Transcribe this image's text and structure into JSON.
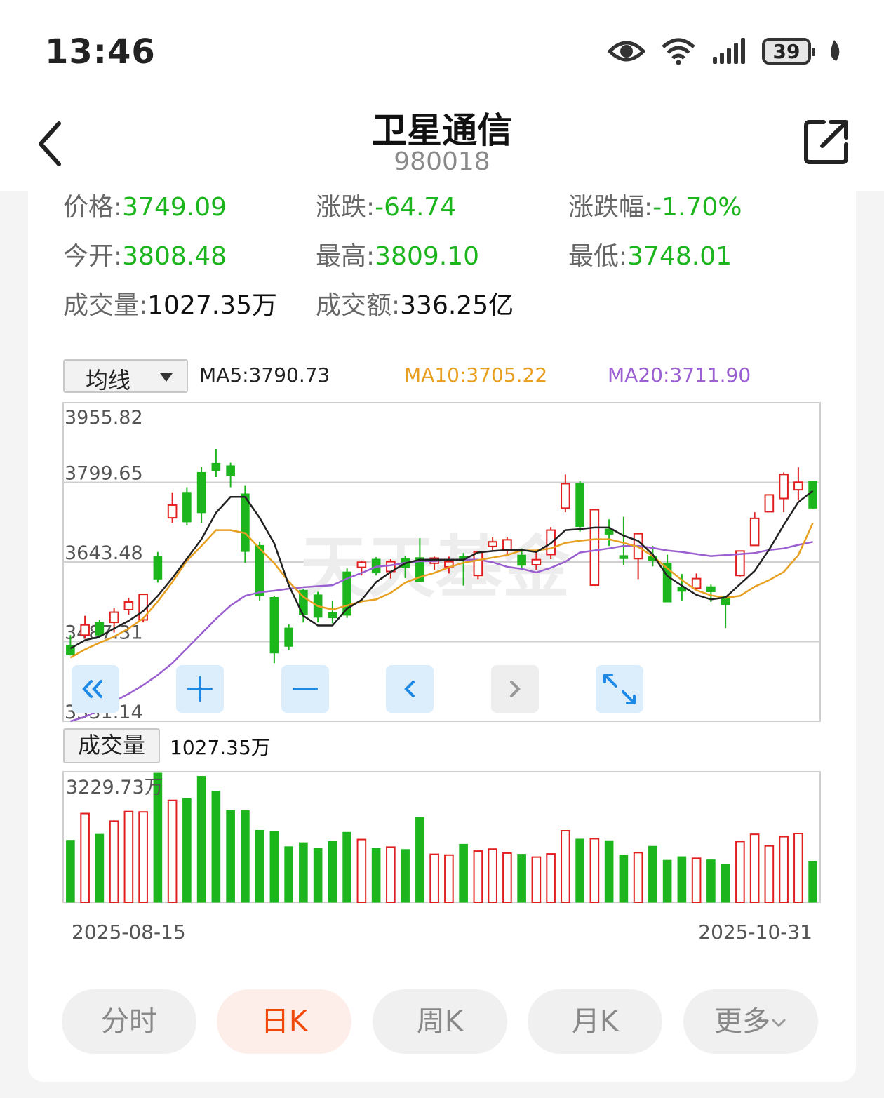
{
  "status_bar": {
    "time": "13:46",
    "battery": "39"
  },
  "header": {
    "title": "卫星通信",
    "code": "980018"
  },
  "quote": {
    "price_label": "价格:",
    "price": "3749.09",
    "change_label": "涨跌:",
    "change": "-64.74",
    "pct_label": "涨跌幅:",
    "pct": "-1.70%",
    "open_label": "今开:",
    "open": "3808.48",
    "high_label": "最高:",
    "high": "3809.10",
    "low_label": "最低:",
    "low": "3748.01",
    "volume_label": "成交量:",
    "volume": "1027.35万",
    "amount_label": "成交额:",
    "amount": "336.25亿"
  },
  "indicator": {
    "select_label": "均线",
    "ma5": "MA5:3790.73",
    "ma10": "MA10:3705.22",
    "ma20": "MA20:3711.90"
  },
  "volume_panel": {
    "label": "成交量",
    "value": "1027.35万"
  },
  "dates": {
    "start": "2025-08-15",
    "end": "2025-10-31"
  },
  "tabs": [
    {
      "label": "分时",
      "active": false
    },
    {
      "label": "日K",
      "active": true
    },
    {
      "label": "周K",
      "active": false
    },
    {
      "label": "月K",
      "active": false
    },
    {
      "label": "更多",
      "active": false
    }
  ],
  "colors": {
    "up": "#e02020",
    "down": "#1db51d",
    "ma5": "#222222",
    "ma10": "#e8a020",
    "ma20": "#9a5fd0",
    "accent": "#f04a0a"
  },
  "chart_data": {
    "type": "candlestick",
    "price_ticks": [
      "3955.82",
      "3799.65",
      "3643.48",
      "3487.31",
      "3331.14"
    ],
    "ylim": [
      3331.14,
      3955.82
    ],
    "volume_max_label": "3229.73万",
    "volume_max": 3229.73,
    "watermark": "天天基金",
    "candles": [
      [
        3480,
        3462,
        3500,
        3460,
        1550
      ],
      [
        3500,
        3520,
        3538,
        3493,
        2220
      ],
      [
        3525,
        3500,
        3530,
        3495,
        1700
      ],
      [
        3525,
        3545,
        3553,
        3505,
        2030
      ],
      [
        3550,
        3565,
        3573,
        3540,
        2270
      ],
      [
        3530,
        3580,
        3580,
        3525,
        2260
      ],
      [
        3655,
        3610,
        3663,
        3603,
        3229
      ],
      [
        3730,
        3755,
        3780,
        3720,
        2550
      ],
      [
        3780,
        3722,
        3790,
        3715,
        2590
      ],
      [
        3819,
        3740,
        3830,
        3720,
        3150
      ],
      [
        3837,
        3822,
        3865,
        3810,
        2780
      ],
      [
        3832,
        3812,
        3838,
        3790,
        2300
      ],
      [
        3777,
        3664,
        3794,
        3642,
        2290
      ],
      [
        3676,
        3577,
        3683,
        3568,
        1800
      ],
      [
        3574,
        3465,
        3577,
        3445,
        1780
      ],
      [
        3514,
        3478,
        3521,
        3470,
        1390
      ],
      [
        3588,
        3540,
        3591,
        3525,
        1490
      ],
      [
        3579,
        3535,
        3585,
        3525,
        1350
      ],
      [
        3544,
        3534,
        3568,
        3523,
        1520
      ],
      [
        3624,
        3539,
        3631,
        3534,
        1750
      ],
      [
        3633,
        3643,
        3646,
        3617,
        1570
      ],
      [
        3649,
        3622,
        3653,
        3617,
        1350
      ],
      [
        3625,
        3644,
        3649,
        3611,
        1380
      ],
      [
        3650,
        3633,
        3656,
        3612,
        1320
      ],
      [
        3652,
        3605,
        3690,
        3605,
        2120
      ],
      [
        3641,
        3651,
        3654,
        3628,
        1200
      ],
      [
        3634,
        3644,
        3654,
        3621,
        1180
      ],
      [
        3655,
        3646,
        3661,
        3597,
        1450
      ],
      [
        3617,
        3663,
        3663,
        3610,
        1280
      ],
      [
        3674,
        3683,
        3692,
        3665,
        1330
      ],
      [
        3666,
        3687,
        3693,
        3660,
        1230
      ],
      [
        3657,
        3637,
        3670,
        3630,
        1200
      ],
      [
        3638,
        3648,
        3664,
        3628,
        1130
      ],
      [
        3658,
        3706,
        3712,
        3649,
        1210
      ],
      [
        3749,
        3797,
        3815,
        3741,
        1790
      ],
      [
        3798,
        3713,
        3802,
        3703,
        1580
      ],
      [
        3598,
        3746,
        3746,
        3598,
        1590
      ],
      [
        3708,
        3698,
        3727,
        3675,
        1540
      ],
      [
        3656,
        3650,
        3732,
        3638,
        1180
      ],
      [
        3650,
        3699,
        3699,
        3610,
        1240
      ],
      [
        3654,
        3646,
        3675,
        3635,
        1400
      ],
      [
        3641,
        3565,
        3658,
        3565,
        1050
      ],
      [
        3594,
        3586,
        3620,
        3568,
        1140
      ],
      [
        3592,
        3611,
        3621,
        3586,
        1100
      ],
      [
        3595,
        3585,
        3599,
        3565,
        1060
      ],
      [
        3576,
        3560,
        3576,
        3514,
        940
      ],
      [
        3617,
        3665,
        3665,
        3615,
        1520
      ],
      [
        3676,
        3729,
        3741,
        3676,
        1700
      ],
      [
        3742,
        3775,
        3775,
        3741,
        1410
      ],
      [
        3768,
        3815,
        3819,
        3741,
        1640
      ],
      [
        3785,
        3800,
        3829,
        3765,
        1720
      ],
      [
        3802,
        3749,
        3803,
        3748,
        1027
      ]
    ],
    "ma5": [
      3474,
      3490,
      3497,
      3513,
      3528,
      3547,
      3577,
      3612,
      3650,
      3688,
      3740,
      3771,
      3771,
      3730,
      3680,
      3598,
      3538,
      3519,
      3519,
      3552,
      3569,
      3604,
      3624,
      3641,
      3648,
      3648,
      3648,
      3648,
      3662,
      3665,
      3667,
      3667,
      3663,
      3680,
      3706,
      3708,
      3711,
      3711,
      3695,
      3685,
      3658,
      3616,
      3597,
      3579,
      3570,
      3574,
      3600,
      3626,
      3668,
      3716,
      3761,
      3783
    ],
    "ma10": [
      3456,
      3472,
      3485,
      3497,
      3513,
      3533,
      3566,
      3604,
      3646,
      3675,
      3706,
      3706,
      3700,
      3670,
      3641,
      3605,
      3575,
      3557,
      3550,
      3558,
      3566,
      3570,
      3583,
      3603,
      3614,
      3622,
      3633,
      3642,
      3647,
      3652,
      3657,
      3666,
      3666,
      3670,
      3681,
      3685,
      3688,
      3688,
      3681,
      3673,
      3655,
      3631,
      3608,
      3588,
      3578,
      3573,
      3577,
      3595,
      3608,
      3624,
      3657,
      3720
    ],
    "ma20": [
      3331,
      3340,
      3353,
      3370,
      3385,
      3402,
      3422,
      3445,
      3474,
      3503,
      3532,
      3558,
      3577,
      3584,
      3587,
      3591,
      3594,
      3596,
      3598,
      3611,
      3622,
      3634,
      3637,
      3642,
      3645,
      3645,
      3648,
      3648,
      3648,
      3643,
      3634,
      3630,
      3623,
      3632,
      3644,
      3662,
      3666,
      3670,
      3675,
      3675,
      3671,
      3666,
      3663,
      3659,
      3655,
      3657,
      3659,
      3661,
      3667,
      3670,
      3677,
      3683
    ]
  }
}
